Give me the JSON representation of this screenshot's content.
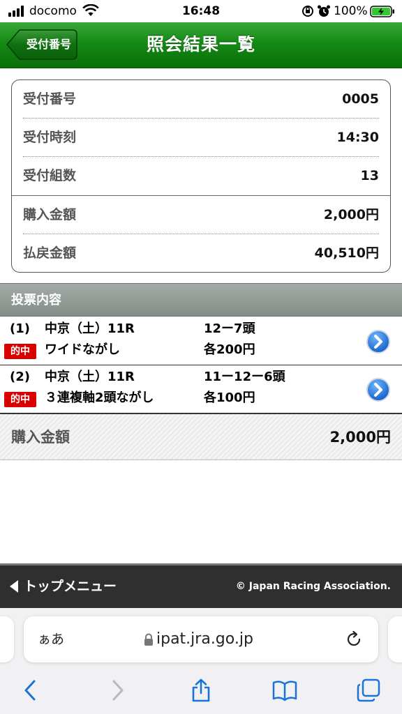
{
  "status_bar": {
    "carrier": "docomo",
    "time": "16:48",
    "battery": "100%",
    "icons": [
      "signal-icon",
      "wifi-icon",
      "orientation-lock-icon",
      "alarm-icon",
      "battery-charging-icon"
    ]
  },
  "header": {
    "back_label": "受付番号",
    "title": "照会結果一覧"
  },
  "info": {
    "rows": [
      {
        "key": "受付番号",
        "value": "0005"
      },
      {
        "key": "受付時刻",
        "value": "14:30"
      },
      {
        "key": "受付組数",
        "value": "13"
      },
      {
        "key": "購入金額",
        "value": "2,000円"
      },
      {
        "key": "払戻金額",
        "value": "40,510円"
      }
    ]
  },
  "section": {
    "label": "投票内容"
  },
  "bets": [
    {
      "num": "(1)",
      "race": "中京（土）11R",
      "combo": "12ー7頭",
      "hit": "的中",
      "type": "ワイドながし",
      "amount": "各200円"
    },
    {
      "num": "(2)",
      "race": "中京（土）11R",
      "combo": "11ー12ー6頭",
      "hit": "的中",
      "type": "３連複軸2頭ながし",
      "amount": "各100円"
    }
  ],
  "total": {
    "label": "購入金額",
    "value": "2,000円"
  },
  "footer": {
    "top_menu": "トップメニュー",
    "copyright": "© Japan Racing Association."
  },
  "browser": {
    "aa": "ぁあ",
    "url": "ipat.jra.go.jp"
  },
  "colors": {
    "header_green": "#138a13",
    "hit_red": "#d80000",
    "link_blue": "#1a73d9",
    "footer_dark": "#2f2f2f"
  }
}
